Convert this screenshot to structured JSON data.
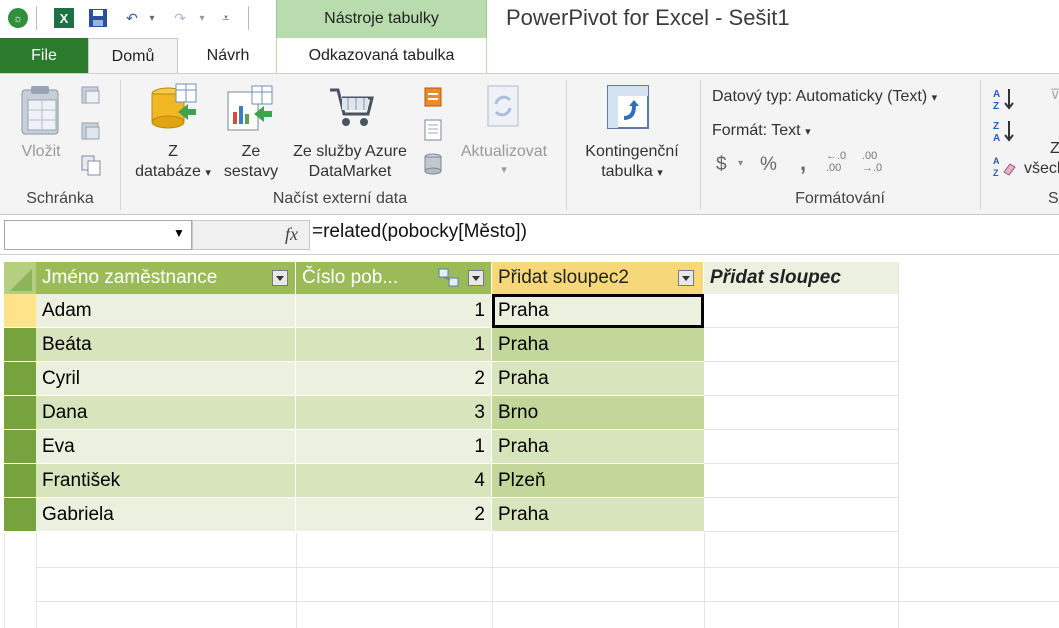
{
  "title_bar": {
    "app_title": "PowerPivot for Excel - Sešit1",
    "contextual_tab_group": "Nástroje tabulky"
  },
  "tabs": [
    {
      "label": "File",
      "active": false
    },
    {
      "label": "Domů",
      "active": true
    },
    {
      "label": "Návrh",
      "active": false
    },
    {
      "label": "Odkazovaná tabulka",
      "active": false
    }
  ],
  "ribbon": {
    "groups": {
      "schranka": "Schránka",
      "nacist": "Načíst externí data",
      "formatovani": "Formátování",
      "sort_partial": "S"
    },
    "buttons": {
      "vlozit": "Vložit",
      "z_databaze_1": "Z",
      "z_databaze_2": "databáze",
      "ze_sestavy_1": "Ze",
      "ze_sestavy_2": "sestavy",
      "azure_1": "Ze služby Azure",
      "azure_2": "DataMarket",
      "aktualizovat": "Aktualizovat",
      "kontingencni_1": "Kontingenční",
      "kontingencni_2": "tabulka",
      "datovy_typ": "Datový typ: Automaticky (Text)",
      "format": "Formát: Text",
      "currency": "$",
      "percent": "%",
      "comma": ",",
      "dec_left": "←.0 .00",
      "dec_right": ".00 →.0",
      "vsech_1": "Z",
      "vsech_2": "všech"
    }
  },
  "formula_bar": {
    "name_box": "",
    "fx": "fx",
    "formula": "=related(pobocky[Město])"
  },
  "table": {
    "columns": [
      "Jméno zaměstnance",
      "Číslo pob...",
      "Přidat sloupec2",
      "Přidat sloupec"
    ],
    "rows": [
      [
        "Adam",
        "1",
        "Praha"
      ],
      [
        "Beáta",
        "1",
        "Praha"
      ],
      [
        "Cyril",
        "2",
        "Praha"
      ],
      [
        "Dana",
        "3",
        "Brno"
      ],
      [
        "Eva",
        "1",
        "Praha"
      ],
      [
        "František",
        "4",
        "Plzeň"
      ],
      [
        "Gabriela",
        "2",
        "Praha"
      ]
    ]
  },
  "colors": {
    "file_tab": "#2c7a2b",
    "context_tab": "#b9dcae",
    "header_green": "#9bbb59",
    "row_header": "#77a33f",
    "selected_row_header": "#ffe38a",
    "selected_col_header": "#f6d87a",
    "cell_green_light": "#ebf1de",
    "cell_green_mid": "#d7e4bc",
    "related_col": "#c4d79b"
  }
}
